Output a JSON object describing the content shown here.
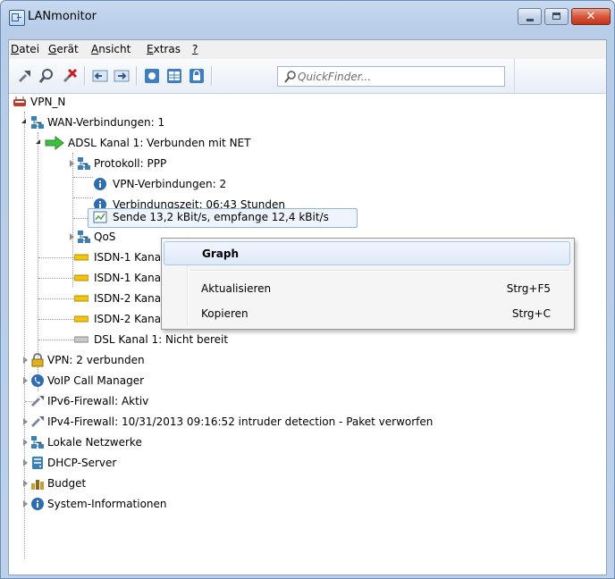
{
  "window": {
    "title": "LANmonitor"
  },
  "menubar": [
    {
      "mnemonic": "D",
      "rest": "atei"
    },
    {
      "mnemonic": "G",
      "rest": "erät"
    },
    {
      "mnemonic": "A",
      "rest": "nsicht"
    },
    {
      "mnemonic": "E",
      "rest": "xtras"
    },
    {
      "mnemonic": "?",
      "rest": ""
    }
  ],
  "toolbar": {
    "icons": [
      "connect-icon",
      "search-device-icon",
      "remove-icon",
      "back-icon",
      "forward-icon",
      "config-icon",
      "table-icon",
      "lock-icon"
    ],
    "quickfinder_placeholder": "QuickFinder..."
  },
  "tree": {
    "root": "VPN_N",
    "wan": "WAN-Verbindungen: 1",
    "adsl": "ADSL Kanal 1: Verbunden mit NET",
    "protokoll": "Protokoll: PPP",
    "vpn_conn": "VPN-Verbindungen: 2",
    "verbindungszeit": "Verbindungszeit: 06:43 Stunden",
    "sende": "Sende 13,2 kBit/s, empfange 12,4 kBit/s",
    "qos": "QoS",
    "isdn1a": "ISDN-1 Kana",
    "isdn1b": "ISDN-1 Kana",
    "isdn2a": "ISDN-2 Kana",
    "isdn2b": "ISDN-2 Kanal 2: Bereit",
    "dsl": "DSL Kanal 1: Nicht bereit",
    "vpn": "VPN: 2 verbunden",
    "voip": "VoIP Call Manager",
    "ipv6": "IPv6-Firewall: Aktiv",
    "ipv4": "IPv4-Firewall: 10/31/2013 09:16:52 intruder detection - Paket verworfen",
    "lokale": "Lokale Netzwerke",
    "dhcp": "DHCP-Server",
    "budget": "Budget",
    "sysinfo": "System-Informationen"
  },
  "context_menu": {
    "graph": "Graph",
    "aktualisieren": "Aktualisieren",
    "aktualisieren_key": "Strg+F5",
    "kopieren": "Kopieren",
    "kopieren_key": "Strg+C"
  },
  "colors": {
    "accent": "#3c7fb1",
    "close_button": "#c4351a",
    "selection_border": "#a8c7ec"
  }
}
